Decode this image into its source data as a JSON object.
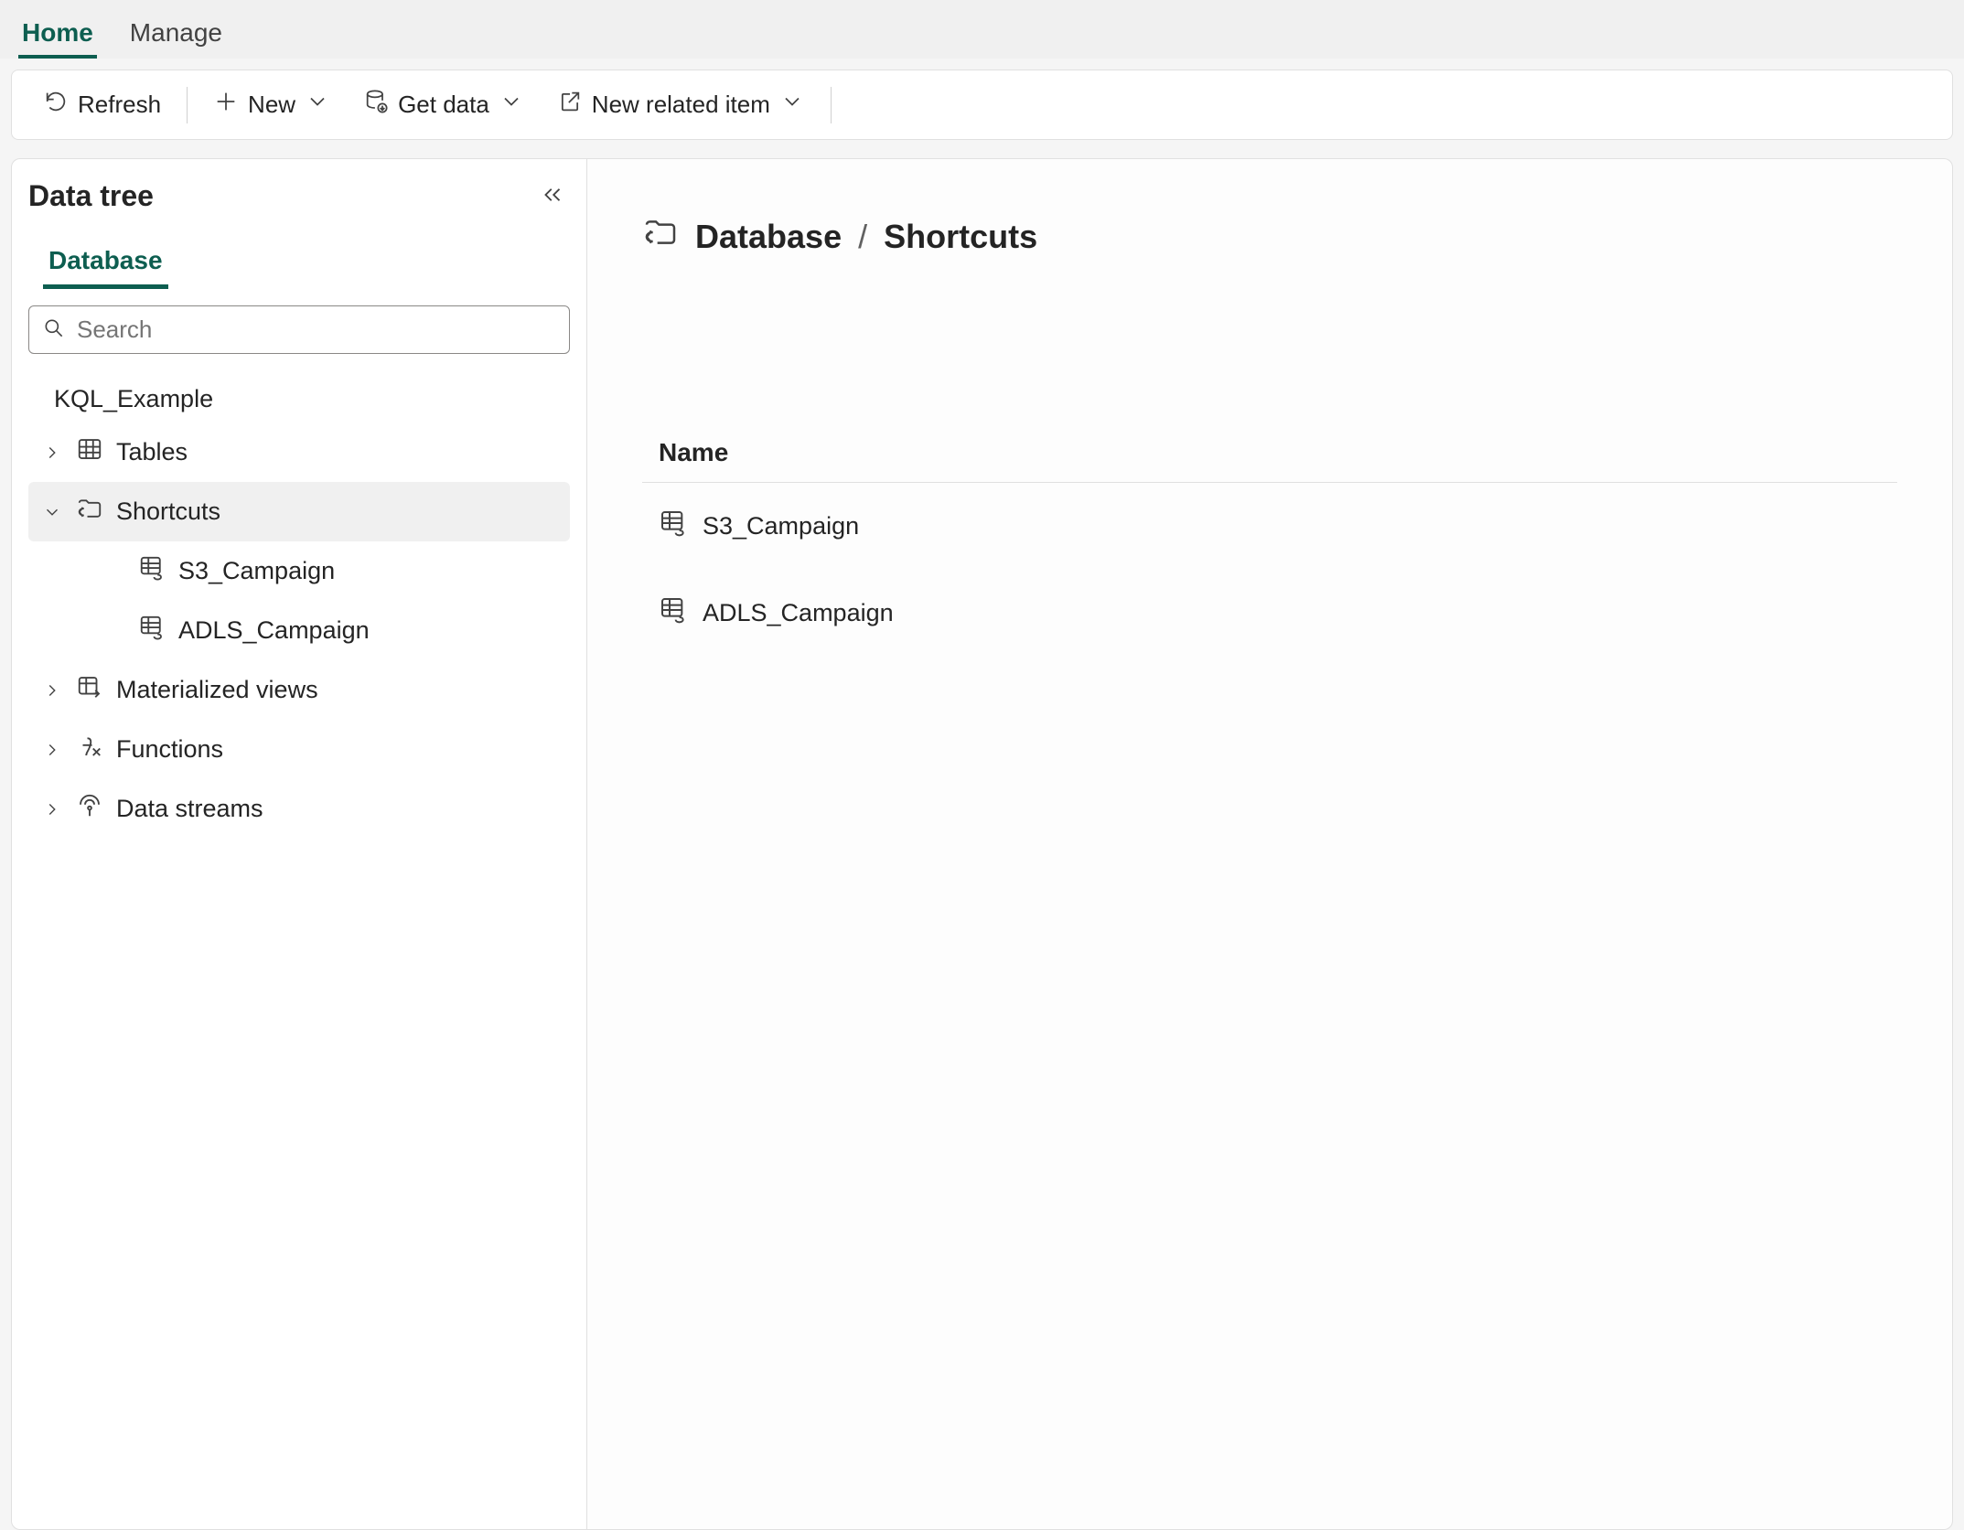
{
  "topTabs": {
    "home": "Home",
    "manage": "Manage",
    "active": "home"
  },
  "toolbar": {
    "refresh": "Refresh",
    "new": "New",
    "getData": "Get data",
    "newRelated": "New related item"
  },
  "sidebar": {
    "title": "Data tree",
    "panelTab": "Database",
    "searchPlaceholder": "Search",
    "root": "KQL_Example",
    "items": {
      "tables": "Tables",
      "shortcuts": "Shortcuts",
      "materialized": "Materialized views",
      "functions": "Functions",
      "dataStreams": "Data streams"
    },
    "shortcutChildren": [
      "S3_Campaign",
      "ADLS_Campaign"
    ]
  },
  "main": {
    "breadcrumb": {
      "root": "Database",
      "current": "Shortcuts"
    },
    "columnHeader": "Name",
    "rows": [
      "S3_Campaign",
      "ADLS_Campaign"
    ]
  }
}
